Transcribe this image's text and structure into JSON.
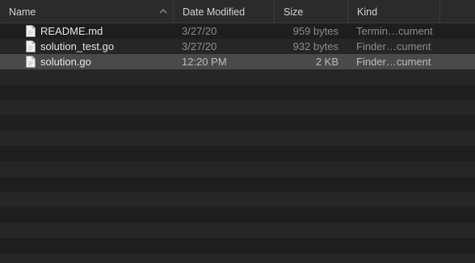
{
  "columns": {
    "name": "Name",
    "date_modified": "Date Modified",
    "size": "Size",
    "kind": "Kind"
  },
  "sort": {
    "column": "name",
    "direction": "ascending",
    "icon": "chevron-up-icon"
  },
  "files": [
    {
      "name": "README.md",
      "date": "3/27/20",
      "size": "959 bytes",
      "kind": "Termin…cument",
      "icon": "document-icon",
      "selected": false
    },
    {
      "name": "solution_test.go",
      "date": "3/27/20",
      "size": "932 bytes",
      "kind": "Finder…cument",
      "icon": "document-icon",
      "selected": false
    },
    {
      "name": "solution.go",
      "date": "12:20 PM",
      "size": "2 KB",
      "kind": "Finder…cument",
      "icon": "document-icon",
      "selected": true
    }
  ],
  "colors": {
    "background": "#1e1e1e",
    "stripe": "#262626",
    "selection": "#4a4a4a",
    "header": "#2b2b2b"
  }
}
